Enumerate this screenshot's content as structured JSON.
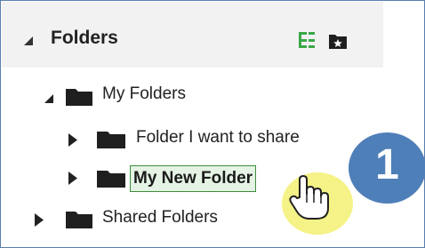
{
  "panel": {
    "title": "Folders"
  },
  "tree": {
    "my_folders": {
      "label": "My Folders",
      "expanded": true
    },
    "children": [
      {
        "label": "Folder I want to share",
        "expanded": false
      },
      {
        "label": "My New Folder",
        "expanded": false,
        "selected": true
      }
    ],
    "shared_folders": {
      "label": "Shared Folders",
      "expanded": false
    }
  },
  "callout": {
    "step_number": "1"
  },
  "icons": {
    "header_collapse": "triangle-down-left-icon",
    "tree_view": "tree-view-icon",
    "favorites_folder": "favorite-folder-icon",
    "folder": "folder-icon",
    "expanded": "triangle-expanded-icon",
    "collapsed": "triangle-collapsed-icon",
    "cursor": "hand-pointer-icon"
  },
  "colors": {
    "header_bg": "#f2f2f2",
    "selection_border": "#3c8c3c",
    "selection_bg": "#e4f3e4",
    "badge": "#4f7fb8",
    "highlight": "#f4f17a",
    "tree_icon_green": "#3aa847"
  }
}
